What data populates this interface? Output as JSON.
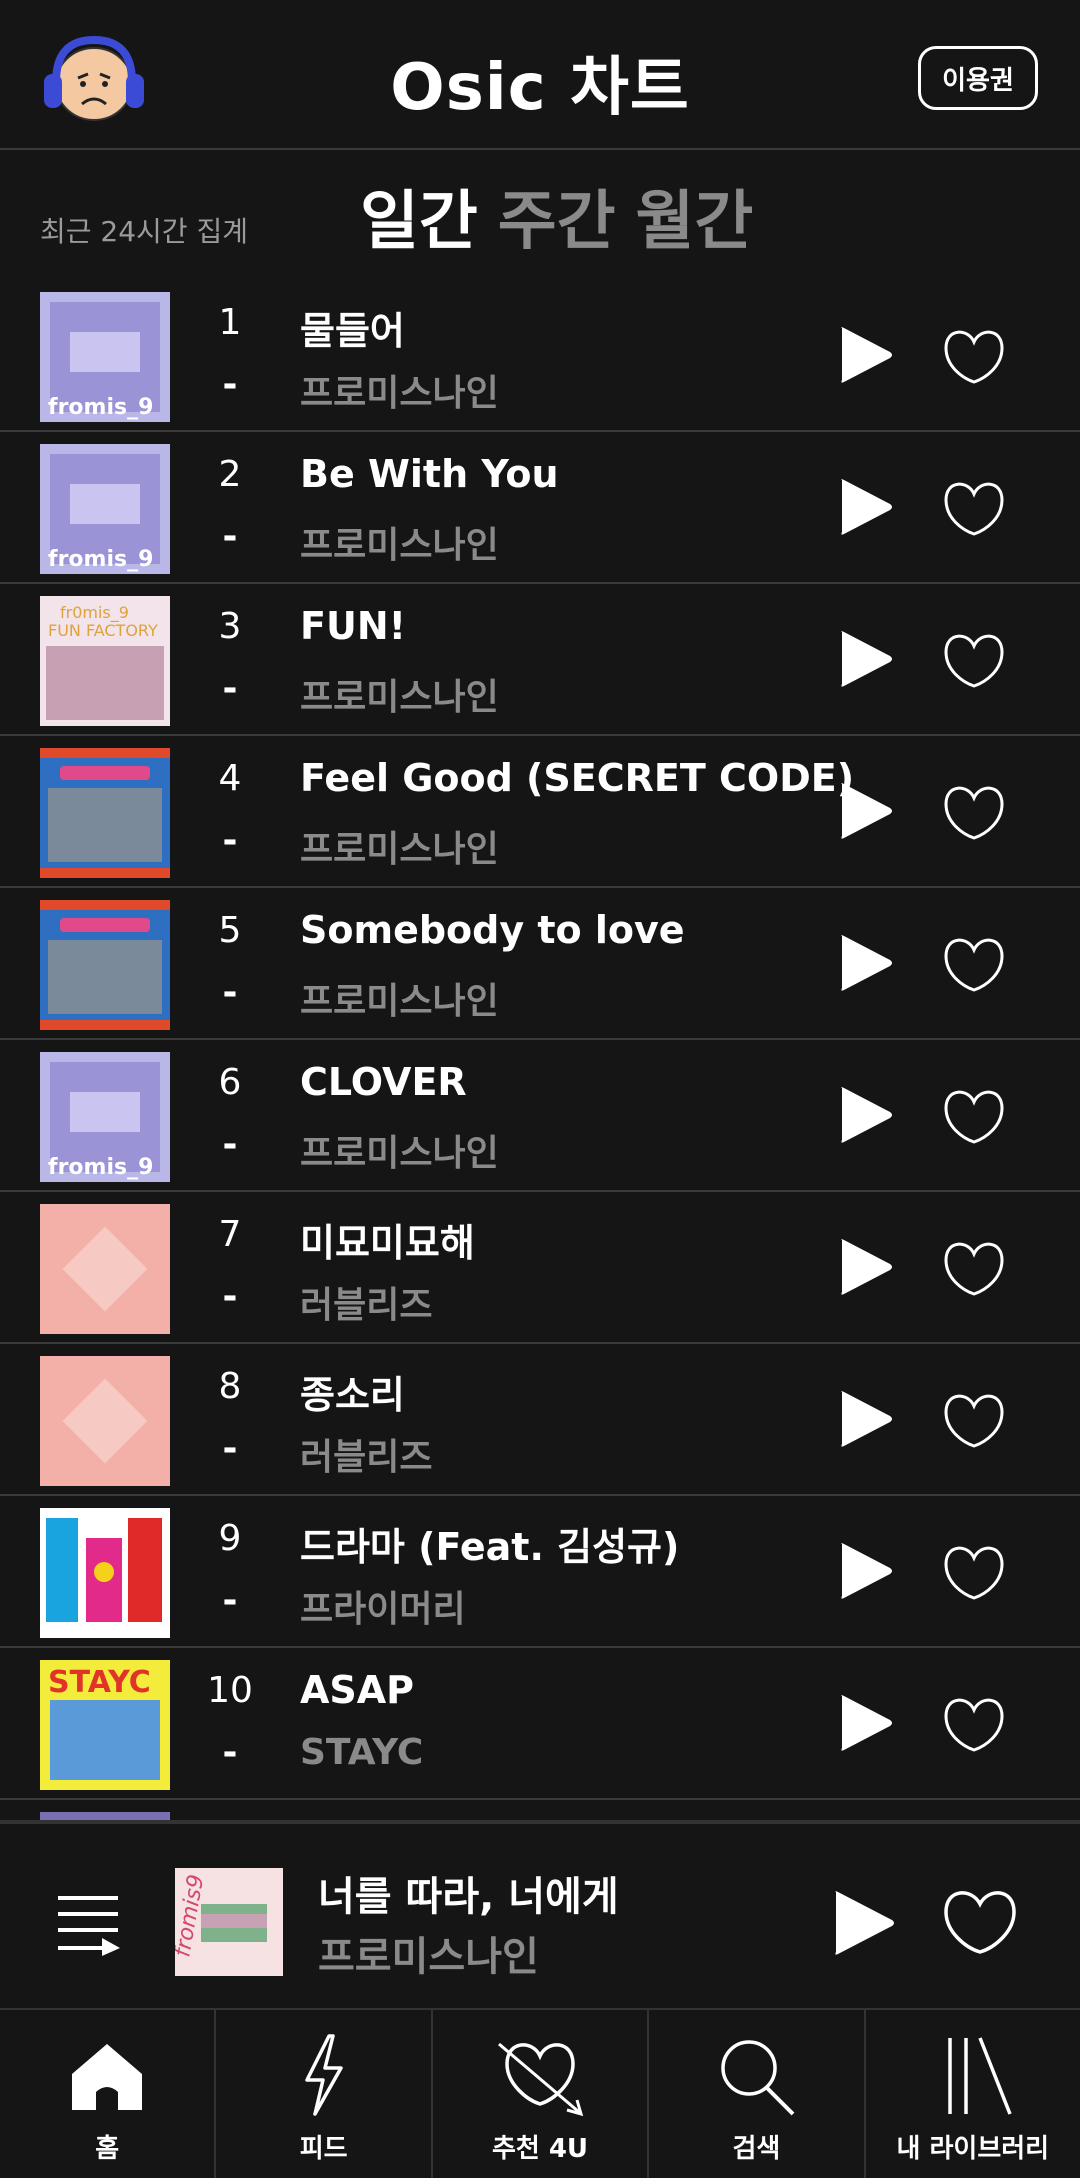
{
  "header": {
    "title": "Osic 차트",
    "ticket_label": "이용권"
  },
  "period": {
    "note": "최근 24시간 집계",
    "tabs": [
      "일간",
      "주간",
      "월간"
    ],
    "active": "일간"
  },
  "songs": [
    {
      "rank": "1",
      "change": "-",
      "title": "물들어",
      "artist": "프로미스나인",
      "cover_icon": "fromis9-album-cover"
    },
    {
      "rank": "2",
      "change": "-",
      "title": "Be With You",
      "artist": "프로미스나인",
      "cover_icon": "fromis9-album-cover"
    },
    {
      "rank": "3",
      "change": "-",
      "title": "FUN!",
      "artist": "프로미스나인",
      "cover_icon": "fun-factory-album-cover"
    },
    {
      "rank": "4",
      "change": "-",
      "title": "Feel Good (SECRET CODE)",
      "artist": "프로미스나인",
      "cover_icon": "my-little-society-album-cover"
    },
    {
      "rank": "5",
      "change": "-",
      "title": "Somebody to love",
      "artist": "프로미스나인",
      "cover_icon": "my-little-society-album-cover"
    },
    {
      "rank": "6",
      "change": "-",
      "title": "CLOVER",
      "artist": "프로미스나인",
      "cover_icon": "fromis9-album-cover"
    },
    {
      "rank": "7",
      "change": "-",
      "title": "미묘미묘해",
      "artist": "러블리즈",
      "cover_icon": "lovelyz-album-cover"
    },
    {
      "rank": "8",
      "change": "-",
      "title": "종소리",
      "artist": "러블리즈",
      "cover_icon": "lovelyz-album-cover"
    },
    {
      "rank": "9",
      "change": "-",
      "title": "드라마 (Feat. 김성규)",
      "artist": "프라이머리",
      "cover_icon": "pop-album-cover"
    },
    {
      "rank": "10",
      "change": "-",
      "title": "ASAP",
      "artist": "STAYC",
      "cover_icon": "stayc-album-cover"
    }
  ],
  "now_playing": {
    "title": "너를 따라, 너에게",
    "artist": "프로미스나인"
  },
  "tabbar": [
    {
      "label": "홈",
      "icon": "home-icon"
    },
    {
      "label": "피드",
      "icon": "lightning-icon"
    },
    {
      "label": "추천 4U",
      "icon": "heart-arrow-icon"
    },
    {
      "label": "검색",
      "icon": "search-icon"
    },
    {
      "label": "내 라이브러리",
      "icon": "library-icon"
    }
  ],
  "colors": {
    "background": "#151515",
    "divider": "#3a3a3a",
    "text": "#ffffff",
    "muted": "#8a8a8a"
  }
}
